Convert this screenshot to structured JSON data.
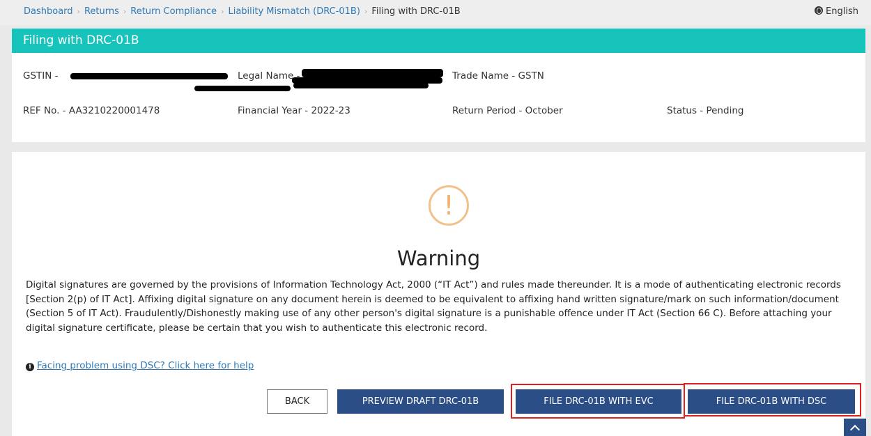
{
  "breadcrumb": {
    "items": [
      "Dashboard",
      "Returns",
      "Return Compliance",
      "Liability Mismatch (DRC-01B)"
    ],
    "current": "Filing with DRC-01B"
  },
  "language": "English",
  "header": {
    "title": "Filing with DRC-01B",
    "gstin_label": "GSTIN - ",
    "legal_name_label": "Legal Name - ",
    "trade_name": "Trade Name - GSTN",
    "ref_no": "REF No. - AA3210220001478",
    "financial_year": "Financial Year - 2022-23",
    "return_period": "Return Period - October",
    "status": "Status - Pending"
  },
  "warning": {
    "icon": "exclamation-circle-icon",
    "title": "Warning",
    "text": "Digital signatures are governed by the provisions of Information Technology Act, 2000 (“IT Act”) and rules made thereunder. It is a mode of authenticating electronic records [Section 2(p) of IT Act]. Affixing digital signature on any document herein is deemed to be equivalent to affixing hand written signature/mark on such information/document (Section 5 of IT Act). Fraudulently/Dishonestly making use of any other person's digital signature is a punishable offence under IT Act (Section 66 C). Before attaching your digital signature certificate, please be certain that you wish to authenticate this electronic record.",
    "help_link": "Facing problem using DSC? Click here for help"
  },
  "buttons": {
    "back": "BACK",
    "preview": "PREVIEW DRAFT DRC-01B",
    "evc": "FILE DRC-01B WITH EVC",
    "dsc": "FILE DRC-01B WITH DSC"
  },
  "colors": {
    "title_bar": "#17c4bb",
    "primary_button": "#2c4e86",
    "highlight": "#e02020",
    "link": "#2f79b7"
  }
}
